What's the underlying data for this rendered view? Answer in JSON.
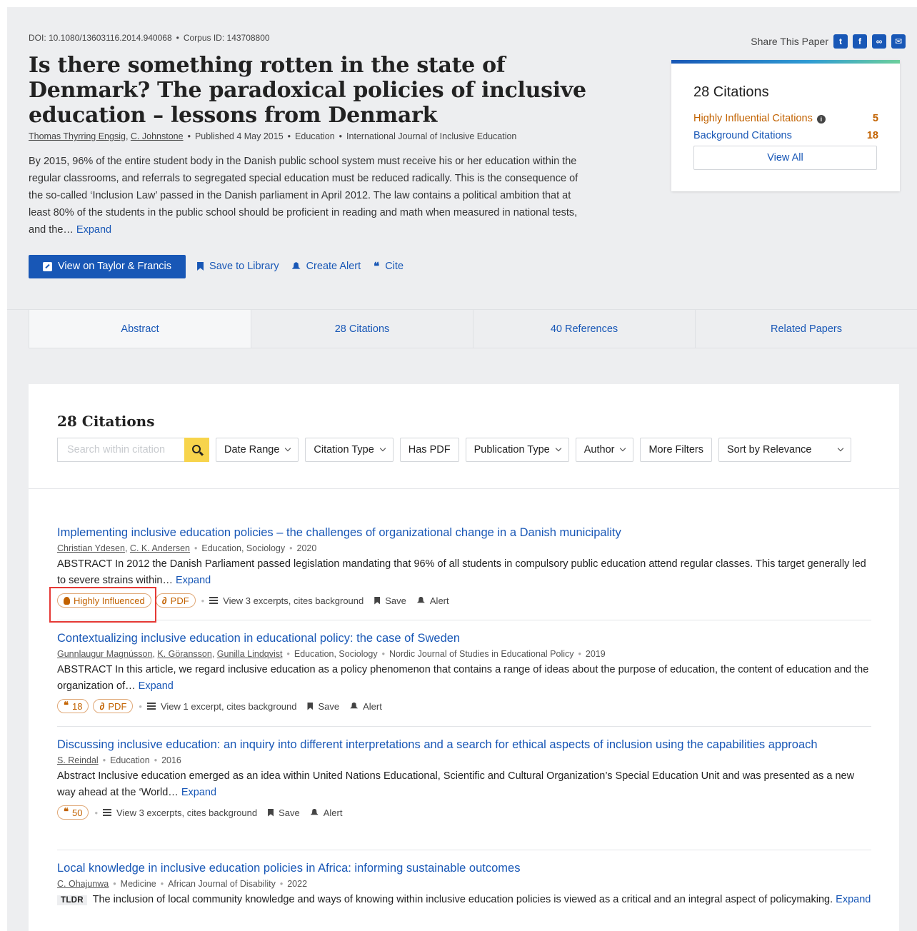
{
  "paper": {
    "doi": "DOI: 10.1080/13603116.2014.940068",
    "corpus_id": "Corpus ID: 143708800",
    "title": "Is there something rotten in the state of Denmark? The paradoxical policies of inclusive education – lessons from Denmark",
    "authors": [
      "Thomas Thyrring Engsig",
      "C. Johnstone"
    ],
    "published": "Published 4 May 2015",
    "field": "Education",
    "venue": "International Journal of Inclusive Education",
    "abstract": "By 2015, 96% of the entire student body in the Danish public school system must receive his or her education within the regular classrooms, and referrals to segregated special education must be reduced radically. This is the consequence of the so-called ‘Inclusion Law’ passed in the Danish parliament in April 2012. The law contains a political ambition that at least 80% of the students in the public school should be proficient in reading and math when measured in national tests, and the…",
    "expand_label": "Expand"
  },
  "share": {
    "label": "Share This Paper"
  },
  "actions": {
    "view_label": "View on Taylor & Francis",
    "save_label": "Save to Library",
    "alert_label": "Create Alert",
    "cite_label": "Cite"
  },
  "citation_card": {
    "heading": "28 Citations",
    "rows": [
      {
        "label": "Highly Influential Citations",
        "count": "5"
      },
      {
        "label": "Background Citations",
        "count": "18"
      }
    ],
    "view_all": "View All"
  },
  "tabs": [
    "Abstract",
    "28 Citations",
    "40 References",
    "Related Papers"
  ],
  "citations": {
    "heading": "28 Citations",
    "search_placeholder": "Search within citation",
    "filters": [
      "Date Range",
      "Citation Type",
      "Has PDF",
      "Publication Type",
      "Author",
      "More Filters"
    ],
    "sort": "Sort by Relevance",
    "items": [
      {
        "title": "Implementing inclusive education policies – the challenges of organizational change in a Danish municipality",
        "authors": [
          "Christian Ydesen",
          "C. K. Andersen"
        ],
        "fields": "Education, Sociology",
        "year": "2020",
        "abstract": "ABSTRACT In 2012 the Danish Parliament passed legislation mandating that 96% of all students in compulsory public education attend regular classes. This target generally led to severe strains within…",
        "expand": "Expand",
        "badge": "Highly Influenced",
        "pdf": "PDF",
        "excerpts": "View 3 excerpts, cites background",
        "save": "Save",
        "alert": "Alert"
      },
      {
        "title": "Contextualizing inclusive education in educational policy: the case of Sweden",
        "authors": [
          "Gunnlaugur Magnússon",
          "K. Göransson",
          "Gunilla Lindqvist"
        ],
        "fields": "Education, Sociology",
        "venue": "Nordic Journal of Studies in Educational Policy",
        "year": "2019",
        "abstract": "ABSTRACT In this article, we regard inclusive education as a policy phenomenon that contains a range of ideas about the purpose of education, the content of education and the organization of…",
        "expand": "Expand",
        "count": "18",
        "pdf": "PDF",
        "excerpts": "View 1 excerpt, cites background",
        "save": "Save",
        "alert": "Alert"
      },
      {
        "title": "Discussing inclusive education: an inquiry into different interpretations and a search for ethical aspects of inclusion using the capabilities approach",
        "authors": [
          "S. Reindal"
        ],
        "fields": "Education",
        "year": "2016",
        "abstract": "Abstract Inclusive education emerged as an idea within United Nations Educational, Scientific and Cultural Organization’s Special Education Unit and was presented as a new way ahead at the ‘World…",
        "expand": "Expand",
        "count": "50",
        "excerpts": "View 3 excerpts, cites background",
        "save": "Save",
        "alert": "Alert"
      },
      {
        "title": "Local knowledge in inclusive education policies in Africa: informing sustainable outcomes",
        "authors": [
          "C. Ohajunwa"
        ],
        "fields": "Medicine",
        "venue": "African Journal of Disability",
        "year": "2022",
        "tldr_label": "TLDR",
        "abstract": "The inclusion of local community knowledge and ways of knowing within inclusive education policies is viewed as a critical and an integral aspect of policymaking.",
        "expand": "Expand"
      }
    ]
  },
  "colors": {
    "primary": "#1857b6",
    "influential": "#c26200",
    "search_button": "#f7d44c",
    "page_background": "#edeef0",
    "annotation_box": "#e53935"
  }
}
